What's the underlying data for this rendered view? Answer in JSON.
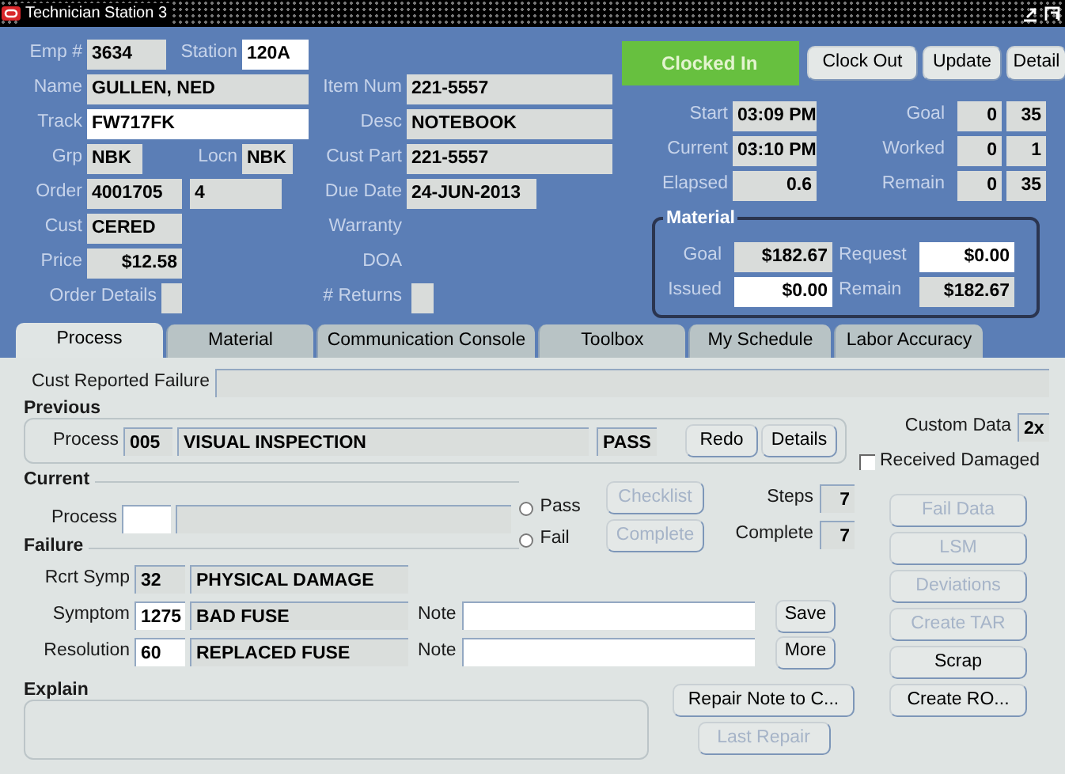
{
  "window": {
    "title": "Technician Station 3"
  },
  "job": {
    "emp": {
      "label": "Emp #",
      "value": "3634",
      "editable": false
    },
    "station": {
      "label": "Station",
      "value": "120A",
      "editable": true
    },
    "name": {
      "label": "Name",
      "value": "GULLEN, NED",
      "editable": false
    },
    "track": {
      "label": "Track",
      "value": "FW717FK",
      "editable": true
    },
    "grp": {
      "label": "Grp",
      "value": "NBK",
      "editable": false
    },
    "locn": {
      "label": "Locn",
      "value": "NBK",
      "editable": false
    },
    "order": {
      "label": "Order",
      "value": "4001705",
      "editable": false
    },
    "order_line": {
      "value": "4",
      "editable": false
    },
    "cust": {
      "label": "Cust",
      "value": "CERED",
      "editable": false
    },
    "price": {
      "label": "Price",
      "value": "$12.58",
      "editable": false
    },
    "order_details": {
      "label": "Order Details",
      "editable": false
    },
    "item_num": {
      "label": "Item Num",
      "value": "221-5557",
      "editable": false
    },
    "desc": {
      "label": "Desc",
      "value": "NOTEBOOK",
      "editable": false
    },
    "cust_part": {
      "label": "Cust Part",
      "value": "221-5557",
      "editable": false
    },
    "due_date": {
      "label": "Due Date",
      "value": "24-JUN-2013",
      "editable": false
    },
    "warranty": {
      "label": "Warranty"
    },
    "doa": {
      "label": "DOA"
    },
    "returns": {
      "label": "# Returns",
      "editable": false
    }
  },
  "clock": {
    "status": "Clocked In",
    "buttons": [
      "Clock Out",
      "Update",
      "Detail"
    ],
    "times": [
      {
        "label": "Start",
        "value": "03:09 PM",
        "editable": false
      },
      {
        "label": "Current",
        "value": "03:10 PM",
        "editable": false
      },
      {
        "label": "Elapsed",
        "value": "0.6",
        "editable": false
      }
    ],
    "counters": [
      {
        "label": "Goal",
        "values": [
          "0",
          "35"
        ]
      },
      {
        "label": "Worked",
        "values": [
          "0",
          "1"
        ]
      },
      {
        "label": "Remain",
        "values": [
          "0",
          "35"
        ]
      }
    ]
  },
  "material": {
    "legend": "Material",
    "goal": {
      "label": "Goal",
      "value": "$182.67",
      "editable": false
    },
    "request": {
      "label": "Request",
      "value": "$0.00",
      "editable": true
    },
    "issued": {
      "label": "Issued",
      "value": "$0.00",
      "editable": true
    },
    "remain": {
      "label": "Remain",
      "value": "$182.67",
      "editable": false
    }
  },
  "tabs": [
    {
      "label": "Process",
      "selected": true
    },
    {
      "label": "Material",
      "selected": false
    },
    {
      "label": "Communication Console",
      "selected": false
    },
    {
      "label": "Toolbox",
      "selected": false
    },
    {
      "label": "My Schedule",
      "selected": false
    },
    {
      "label": "Labor Accuracy",
      "selected": false
    }
  ],
  "process": {
    "cust_reported_failure": {
      "label": "Cust Reported Failure",
      "editable": false
    },
    "previous": {
      "legend": "Previous",
      "label": "Process",
      "code": "005",
      "description": "VISUAL INSPECTION",
      "result": "PASS",
      "buttons": [
        {
          "label": "Redo",
          "disabled": false
        },
        {
          "label": "Details",
          "disabled": false
        }
      ]
    },
    "custom_data": {
      "label": "Custom Data",
      "value": "2x"
    },
    "received_damaged": {
      "label": "Received Damaged",
      "checked": false
    },
    "current": {
      "legend": "Current",
      "label": "Process",
      "radios": [
        {
          "label": "Pass",
          "selected": false
        },
        {
          "label": "Fail",
          "selected": false
        }
      ],
      "buttons": [
        {
          "label": "Checklist",
          "disabled": true
        },
        {
          "label": "Complete",
          "disabled": true
        }
      ],
      "steps": {
        "label": "Steps",
        "value": "7"
      },
      "complete": {
        "label": "Complete",
        "value": "7"
      }
    },
    "failure": {
      "legend": "Failure",
      "rows": [
        {
          "label": "Rcrt Symp",
          "code": "32",
          "code_editable": false,
          "description": "PHYSICAL DAMAGE"
        },
        {
          "label": "Symptom",
          "code": "1275",
          "code_editable": true,
          "description": "BAD FUSE",
          "note_label": "Note",
          "button": {
            "label": "Save",
            "disabled": false
          }
        },
        {
          "label": "Resolution",
          "code": "60",
          "code_editable": true,
          "description": "REPLACED FUSE",
          "note_label": "Note",
          "button": {
            "label": "More",
            "disabled": false
          }
        }
      ]
    },
    "explain": {
      "legend": "Explain"
    },
    "repair_buttons": [
      {
        "label": "Repair Note to C...",
        "disabled": false
      },
      {
        "label": "Last Repair",
        "disabled": true
      }
    ],
    "side_buttons": [
      {
        "label": "Fail Data",
        "disabled": true
      },
      {
        "label": "LSM",
        "disabled": true
      },
      {
        "label": "Deviations",
        "disabled": true
      },
      {
        "label": "Create TAR",
        "disabled": true
      },
      {
        "label": "Scrap",
        "disabled": false
      },
      {
        "label": "Create RO...",
        "disabled": false
      }
    ]
  }
}
